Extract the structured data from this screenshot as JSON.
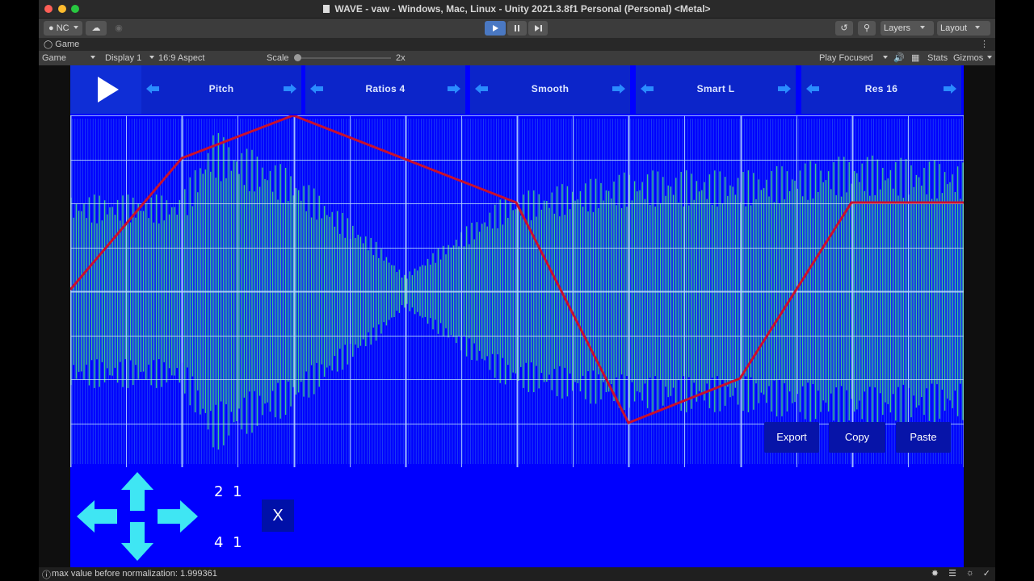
{
  "window": {
    "title": "WAVE - vaw - Windows, Mac, Linux - Unity 2021.3.8f1 Personal (Personal) <Metal>"
  },
  "toolbar": {
    "account_label": "NC",
    "layers_label": "Layers",
    "layout_label": "Layout"
  },
  "tab": {
    "label": "Game"
  },
  "gamebar": {
    "view_select": "Game",
    "display_select": "Display 1",
    "aspect_select": "16:9 Aspect",
    "scale_label": "Scale",
    "scale_value": "2x",
    "play_mode_select": "Play Focused",
    "stats_label": "Stats",
    "gizmos_label": "Gizmos"
  },
  "game": {
    "params": [
      {
        "label": "Pitch"
      },
      {
        "label": "Ratios 4"
      },
      {
        "label": "Smooth"
      },
      {
        "label": "Smart L"
      },
      {
        "label": "Res 16"
      }
    ],
    "buttons": {
      "export": "Export",
      "copy": "Copy",
      "paste": "Paste",
      "close": "X"
    },
    "ratio_top": "2 1",
    "ratio_bottom": "4 1",
    "colors": {
      "background": "#0000fe",
      "header": "#0c25c9",
      "waveform": "#46e87a",
      "grid": "#b8d8ff",
      "envelope": "#c8102e",
      "arrows": "#3fe6f3"
    }
  },
  "status": {
    "message": "max value before normalization: 1.999361"
  }
}
